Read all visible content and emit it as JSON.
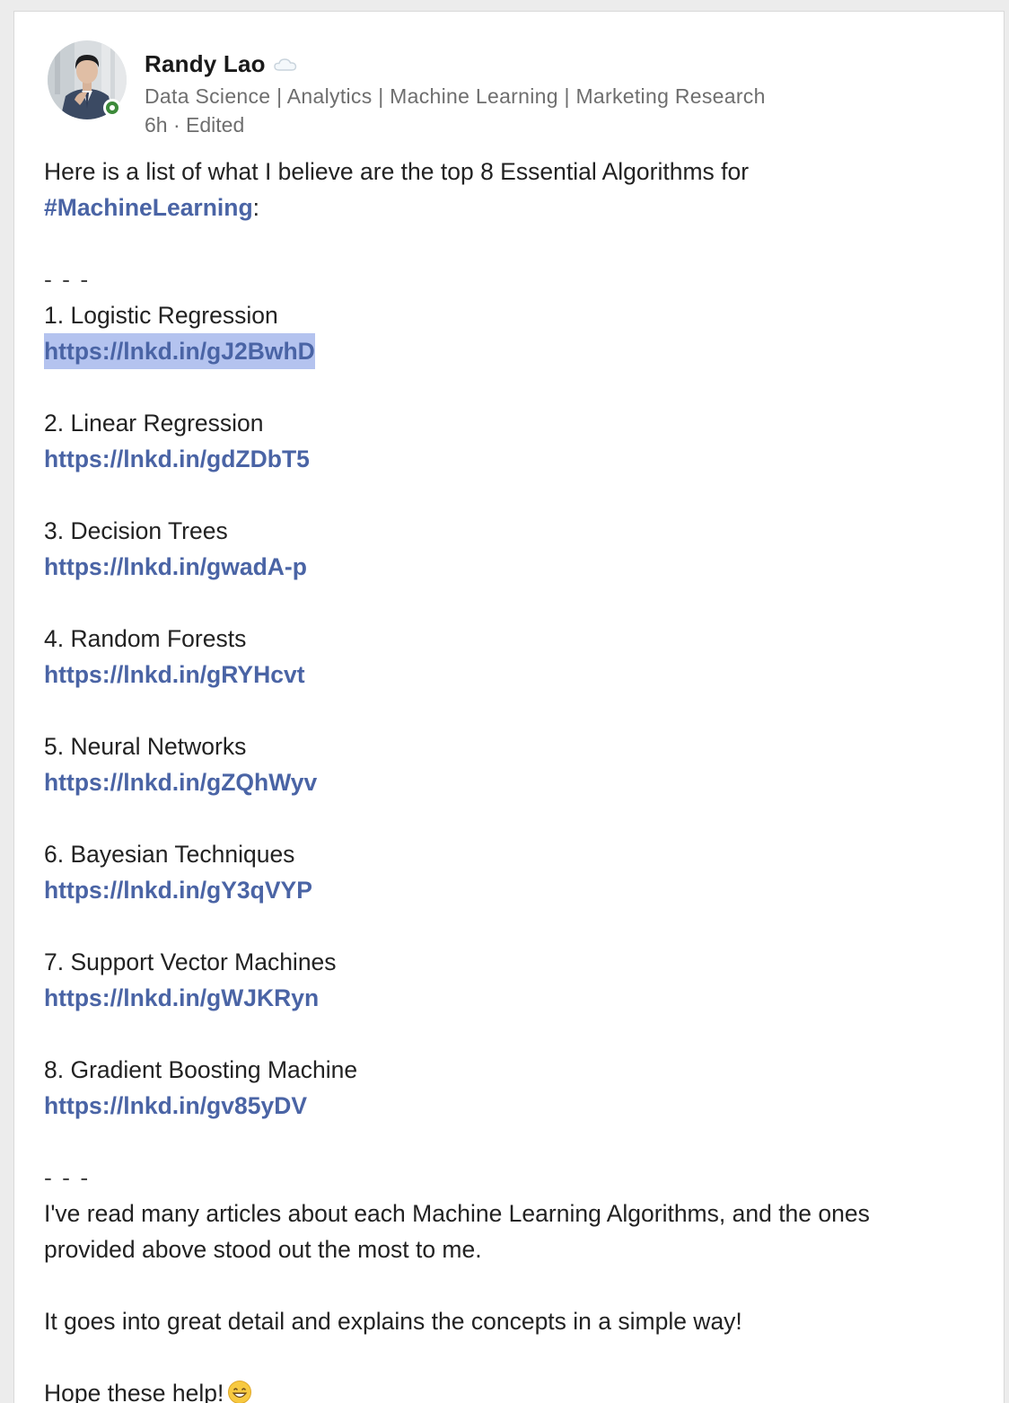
{
  "post": {
    "author": {
      "name": "Randy Lao",
      "headline": "Data Science | Analytics | Machine Learning | Marketing Research",
      "time": "6h",
      "edited": "Edited",
      "meta_separator": "·",
      "presence_color": "#3d8a3a",
      "badge_icon": "cloud-icon"
    },
    "intro": "Here is a list of what I believe are the top 8 Essential Algorithms for",
    "hashtag": "#MachineLearning",
    "intro_suffix": ":",
    "separator": "- - -",
    "algorithms": [
      {
        "label": "1. Logistic Regression",
        "url": "https://lnkd.in/gJ2BwhD",
        "selected": true
      },
      {
        "label": "2. Linear Regression",
        "url": "https://lnkd.in/gdZDbT5"
      },
      {
        "label": "3. Decision Trees",
        "url": "https://lnkd.in/gwadA-p"
      },
      {
        "label": "4. Random Forests",
        "url": "https://lnkd.in/gRYHcvt"
      },
      {
        "label": "5. Neural Networks",
        "url": "https://lnkd.in/gZQhWyv"
      },
      {
        "label": "6. Bayesian Techniques",
        "url": "https://lnkd.in/gY3qVYP"
      },
      {
        "label": "7. Support Vector Machines",
        "url": "https://lnkd.in/gWJKRyn"
      },
      {
        "label": "8. Gradient Boosting Machine",
        "url": "https://lnkd.in/gv85yDV"
      }
    ],
    "closing_separator": "- - -",
    "outro_1_line_1": "I've read many articles about each Machine Learning Algorithms, and the ones",
    "outro_1_line_2": "provided above stood out the most to me.",
    "outro_2": "It goes into great detail and explains the concepts in a simple way!",
    "outro_3": "Hope these help!",
    "outro_emoji": "grinning-face-emoji",
    "link_color": "#4a64a5",
    "selection_color": "#b4c3ef"
  }
}
